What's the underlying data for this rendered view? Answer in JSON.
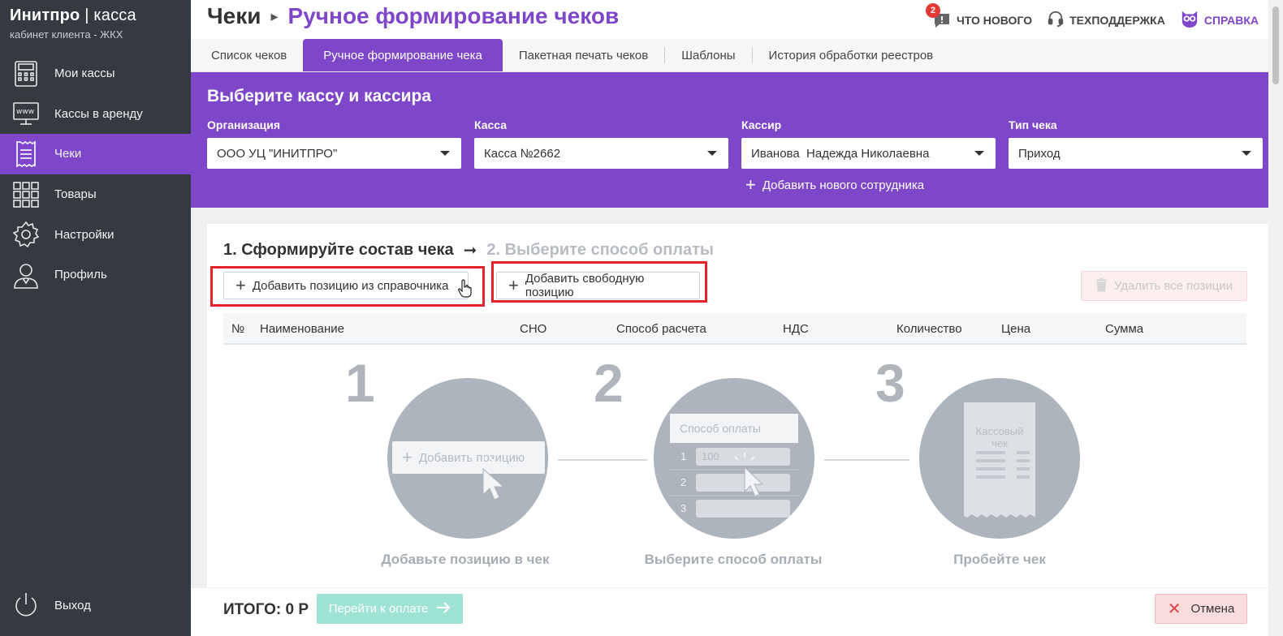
{
  "brand": {
    "name_bold": "Инитпро",
    "name_sep": " | ",
    "name_thin": "касса",
    "subtitle": "кабинет клиента - ЖКХ"
  },
  "sidebar": {
    "items": [
      {
        "label": "Мои кассы",
        "icon": "cash-register-icon"
      },
      {
        "label": "Кассы в аренду",
        "icon": "www-monitor-icon"
      },
      {
        "label": "Чеки",
        "icon": "receipt-icon",
        "active": true
      },
      {
        "label": "Товары",
        "icon": "grid-icon"
      },
      {
        "label": "Настройки",
        "icon": "gear-icon"
      },
      {
        "label": "Профиль",
        "icon": "user-icon"
      }
    ],
    "logout_label": "Выход"
  },
  "header": {
    "crumb_root": "Чеки",
    "crumb_current": "Ручное формирование чеков",
    "whats_new": "ЧТО НОВОГО",
    "whats_new_badge": "2",
    "support": "ТЕХПОДДЕРЖКА",
    "help": "СПРАВКА"
  },
  "tabs": [
    {
      "label": "Список чеков"
    },
    {
      "label": "Ручное формирование чека",
      "active": true
    },
    {
      "label": "Пакетная печать чеков"
    },
    {
      "label": "Шаблоны"
    },
    {
      "label": "История обработки реестров"
    }
  ],
  "panel": {
    "title": "Выберите кассу и кассира",
    "fields": [
      {
        "label": "Организация",
        "value": "ООО УЦ \"ИНИТПРО\""
      },
      {
        "label": "Касса",
        "value": "Касса №2662"
      },
      {
        "label": "Кассир",
        "value": "Иванова  Надежда Николаевна"
      },
      {
        "label": "Тип чека",
        "value": "Приход"
      }
    ],
    "add_employee": "Добавить нового сотрудника"
  },
  "card": {
    "step1": "1. Сформируйте состав чека",
    "step2": "2. Выберите способ оплаты",
    "add_from_catalog": "Добавить позицию из справочника",
    "add_free": "Добавить свободную позицию",
    "delete_all": "Удалить все позиции",
    "columns": [
      "№",
      "Наименование",
      "СНО",
      "Способ расчета",
      "НДС",
      "Количество",
      "Цена",
      "Сумма"
    ]
  },
  "guide": {
    "steps": [
      {
        "num": "1",
        "caption": "Добавьте позицию в чек",
        "demo_button": "Добавить позицию"
      },
      {
        "num": "2",
        "caption": "Выберите способ оплаты",
        "demo_header": "Способ оплаты",
        "rows": [
          "1",
          "2",
          "3"
        ],
        "demo_value": "100"
      },
      {
        "num": "3",
        "caption": "Пробейте чек",
        "receipt_title": "Кассовый чек"
      }
    ]
  },
  "footer": {
    "total": "ИТОГО: 0 Р",
    "pay_button": "Перейти к оплате",
    "cancel_button": "Отмена"
  },
  "colors": {
    "accent": "#7e47c9",
    "sidebar": "#353a40",
    "highlight": "#e3232a"
  }
}
